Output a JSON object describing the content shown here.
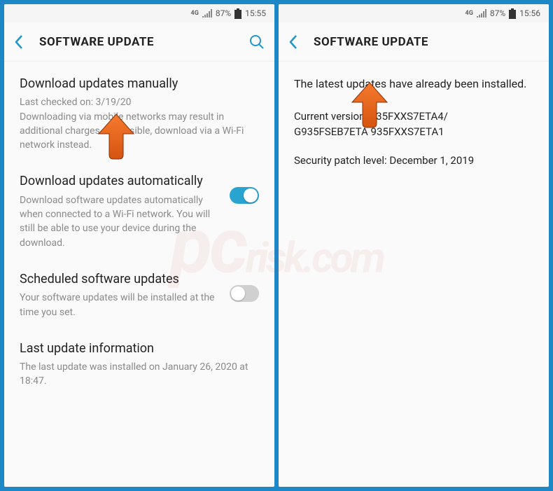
{
  "left": {
    "status": {
      "network": "4G",
      "battery": "87%",
      "time": "15:55"
    },
    "header": {
      "title": "SOFTWARE UPDATE"
    },
    "sections": {
      "manual": {
        "title": "Download updates manually",
        "desc": "Last checked on: 3/19/20\nDownloading via mobile networks may result in additional charges. If possible, download via a Wi-Fi network instead."
      },
      "auto": {
        "title": "Download updates automatically",
        "desc": "Download software updates automatically when connected to a Wi-Fi network. You will still be able to use your device during the download.",
        "toggle": "on"
      },
      "scheduled": {
        "title": "Scheduled software updates",
        "desc": "Your software updates will be installed at the time you set.",
        "toggle": "off"
      },
      "last": {
        "title": "Last update information",
        "desc": "The last update was installed on January 26, 2020 at 18:47."
      }
    }
  },
  "right": {
    "status": {
      "network": "4G",
      "battery": "87%",
      "time": "15:56"
    },
    "header": {
      "title": "SOFTWARE UPDATE"
    },
    "body": {
      "message": "The latest updates have already been installed.",
      "version_label": "Current version:",
      "version_lines": "935FXXS7ETA4/\nG935FSEB7ETA    935FXXS7ETA1",
      "security": "Security patch level: December 1, 2019"
    }
  },
  "watermark": {
    "main": "pc",
    "sub": "risk.com"
  }
}
